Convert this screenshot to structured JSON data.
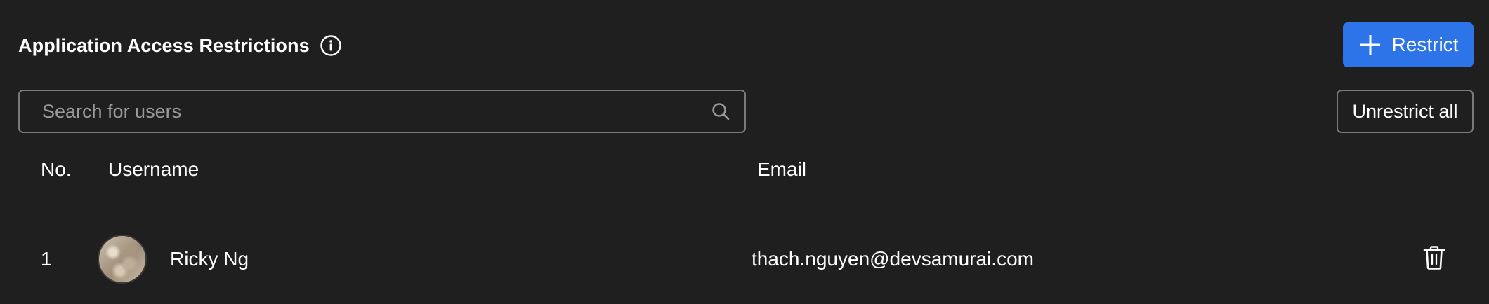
{
  "header": {
    "title": "Application Access Restrictions",
    "info_icon": "info-circle-icon",
    "restrict_label": "Restrict",
    "restrict_icon": "plus-icon"
  },
  "search": {
    "placeholder": "Search for users",
    "value": "",
    "icon": "search-icon"
  },
  "actions": {
    "unrestrict_all_label": "Unrestrict all"
  },
  "table": {
    "columns": [
      "No.",
      "Username",
      "Email"
    ],
    "rows": [
      {
        "no": "1",
        "username": "Ricky Ng",
        "email": "thach.nguyen@devsamurai.com",
        "delete_icon": "trash-icon"
      }
    ]
  },
  "colors": {
    "background": "#1f1f1f",
    "accent": "#2d74e8",
    "border": "#7a7a7a",
    "text": "#ffffff",
    "placeholder": "#9a9a9a"
  }
}
